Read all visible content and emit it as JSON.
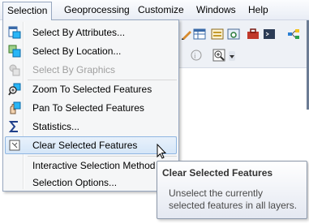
{
  "menubar": {
    "items": [
      "Selection",
      "Geoprocessing",
      "Customize",
      "Windows",
      "Help"
    ],
    "active_index": 0
  },
  "menu": {
    "items": [
      {
        "label": "Select By Attributes...",
        "icon": "select-by-attributes-icon",
        "enabled": true
      },
      {
        "label": "Select By Location...",
        "icon": "select-by-location-icon",
        "enabled": true
      },
      {
        "label": "Select By Graphics",
        "icon": "select-by-graphics-icon",
        "enabled": false
      },
      {
        "label": "Zoom To Selected Features",
        "icon": "zoom-to-selected-icon",
        "enabled": true
      },
      {
        "label": "Pan To Selected Features",
        "icon": "pan-to-selected-icon",
        "enabled": true
      },
      {
        "label": "Statistics...",
        "icon": "sigma-statistics-icon",
        "enabled": true
      },
      {
        "label": "Clear Selected Features",
        "icon": "clear-selection-icon",
        "enabled": true,
        "hovered": true
      },
      {
        "label": "Interactive Selection Method",
        "icon": "",
        "enabled": true,
        "submenu": true
      },
      {
        "label": "Selection Options...",
        "icon": "",
        "enabled": true
      }
    ]
  },
  "tooltip": {
    "title": "Clear Selected Features",
    "body": "Unselect the currently selected features in all layers."
  },
  "colors": {
    "menu_border": "#97a7bf",
    "hover_fill": "#d5e6f8",
    "hover_border": "#8fb6e2"
  }
}
